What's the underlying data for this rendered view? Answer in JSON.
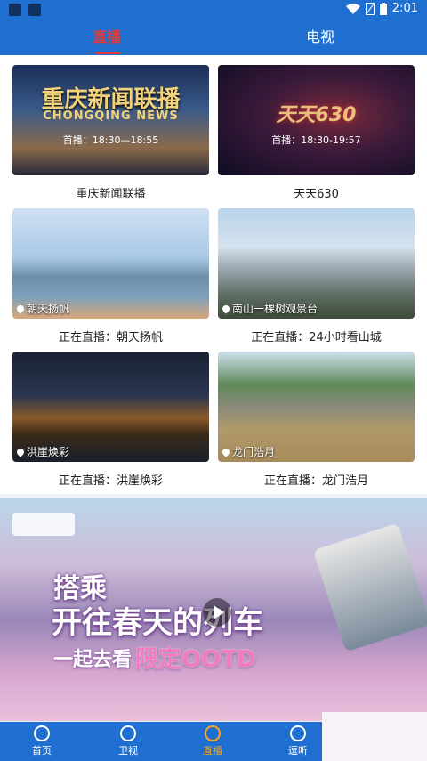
{
  "status_bar": {
    "time": "2:01"
  },
  "tabs": [
    {
      "label": "直播",
      "active": true
    },
    {
      "label": "电视",
      "active": false
    }
  ],
  "channels": [
    {
      "thumb_title": "重庆新闻联播",
      "thumb_subtitle": "CHONGQING NEWS",
      "time_text": "首播：18:30—18:55",
      "caption": "重庆新闻联播"
    },
    {
      "thumb_title": "天天630",
      "time_text": "首播：18:30-19:57",
      "caption": "天天630"
    }
  ],
  "live_streams": [
    {
      "tag": "朝天扬帆",
      "caption": "正在直播：朝天扬帆"
    },
    {
      "tag": "南山一棵树观景台",
      "caption": "正在直播：24小时看山城"
    },
    {
      "tag": "洪崖焕彩",
      "caption": "正在直播：洪崖焕彩"
    },
    {
      "tag": "龙门浩月",
      "caption": "正在直播：龙门浩月"
    }
  ],
  "banner": {
    "line1": "搭乘",
    "line2": "开往春天的列车",
    "line3_a": "一起去看",
    "line3_b": "限定OOTD"
  },
  "bottom_nav": [
    {
      "label": "首页",
      "icon": "star-icon",
      "active": false
    },
    {
      "label": "卫视",
      "icon": "lightning-icon",
      "active": false
    },
    {
      "label": "直播",
      "icon": "tv-icon",
      "active": true
    },
    {
      "label": "逗听",
      "icon": "radio-icon",
      "active": false
    }
  ],
  "colors": {
    "primary": "#1f6fd1",
    "active_tab": "#e53935",
    "active_nav": "#f5a623"
  }
}
